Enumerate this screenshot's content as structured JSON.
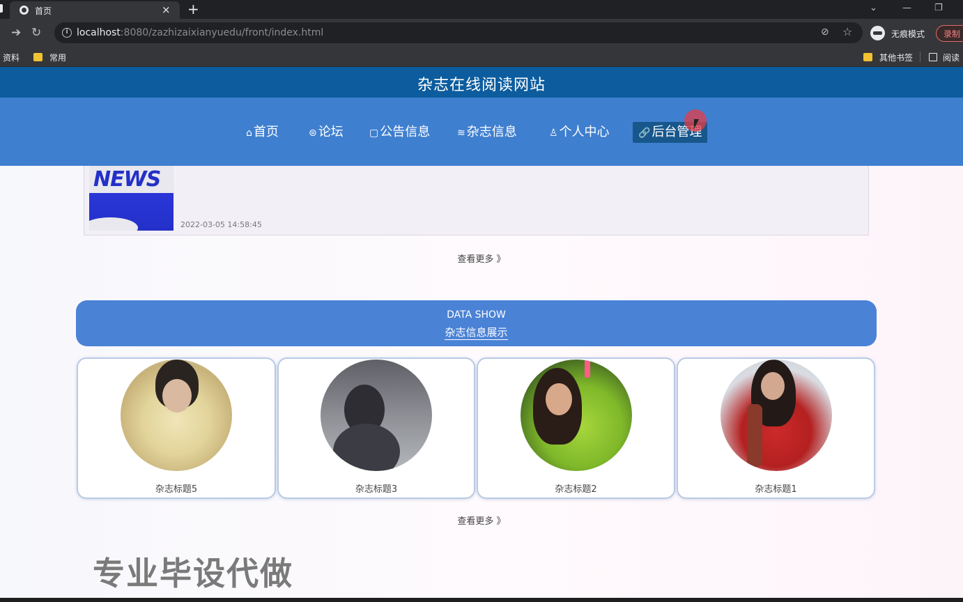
{
  "browser": {
    "tab_title": "首页",
    "tab_close": "×",
    "new_tab": "+",
    "win_controls": [
      "⌄",
      "—",
      "❐"
    ],
    "url_host": "localhost",
    "url_rest": ":8080/zazhizaixianyuedu/front/index.html",
    "incognito_label": "无痕模式",
    "record_label": "录制",
    "bookmarks": [
      "资料",
      "常用"
    ],
    "bookmarks_right": [
      "其他书签",
      "阅读"
    ]
  },
  "site": {
    "title": "杂志在线阅读网站"
  },
  "nav": {
    "items": [
      {
        "icon": "⌂",
        "label": "首页"
      },
      {
        "icon": "⊜",
        "label": "论坛"
      },
      {
        "icon": "▢",
        "label": "公告信息"
      },
      {
        "icon": "≋",
        "label": "杂志信息"
      },
      {
        "icon": "♙",
        "label": "个人中心"
      },
      {
        "icon": "🔗",
        "label": "后台管理"
      }
    ]
  },
  "news": {
    "thumb_text": "NEWS",
    "date": "2022-03-05 14:58:45"
  },
  "see_more_1": "查看更多 》",
  "data_show": {
    "en": "DATA SHOW",
    "cn": "杂志信息展示"
  },
  "magazines": [
    {
      "title": "杂志标题5"
    },
    {
      "title": "杂志标题3"
    },
    {
      "title": "杂志标题2"
    },
    {
      "title": "杂志标题1"
    }
  ],
  "see_more_2": "查看更多 》",
  "watermark": "专业毕设代做"
}
